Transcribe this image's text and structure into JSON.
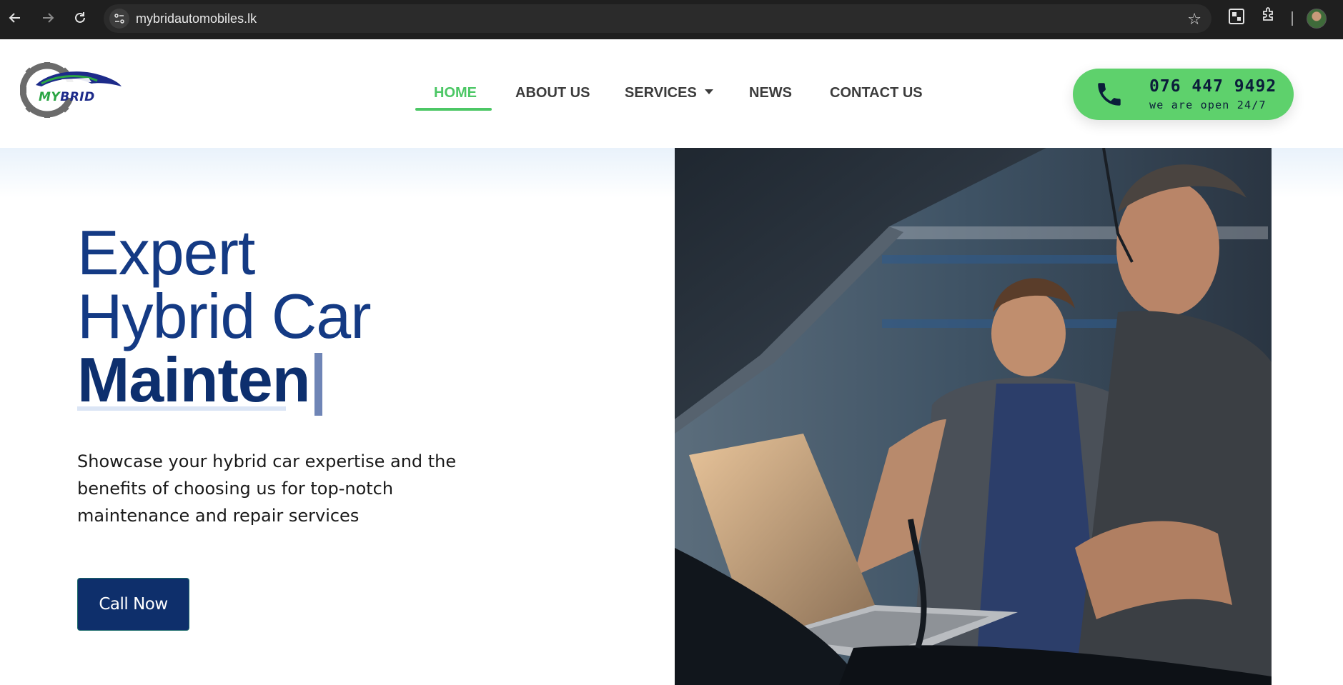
{
  "browser": {
    "url": "mybridautomobiles.lk"
  },
  "header": {
    "logo": {
      "brand_prefix": "MY",
      "brand_suffix": "BRID"
    },
    "nav": [
      {
        "label": "HOME",
        "active": true
      },
      {
        "label": "ABOUT US",
        "active": false
      },
      {
        "label": "SERVICES",
        "active": false,
        "has_dropdown": true
      },
      {
        "label": "NEWS",
        "active": false
      },
      {
        "label": "CONTACT US",
        "active": false
      }
    ],
    "contact": {
      "phone": "076 447 9492",
      "hours": "we are open 24/7",
      "icon": "phone-icon"
    }
  },
  "hero": {
    "line1": "Expert",
    "line2": "Hybrid Car",
    "line3": "Mainten",
    "description": "Showcase your hybrid car expertise and the benefits of choosing us for top-notch maintenance and repair services",
    "cta_label": "Call Now"
  },
  "colors": {
    "accent_green": "#4cc765",
    "phone_pill": "#5ed16c",
    "heading_blue": "#143a84",
    "button_navy": "#0e2f6b",
    "chrome_dark": "#1f1f1f"
  }
}
